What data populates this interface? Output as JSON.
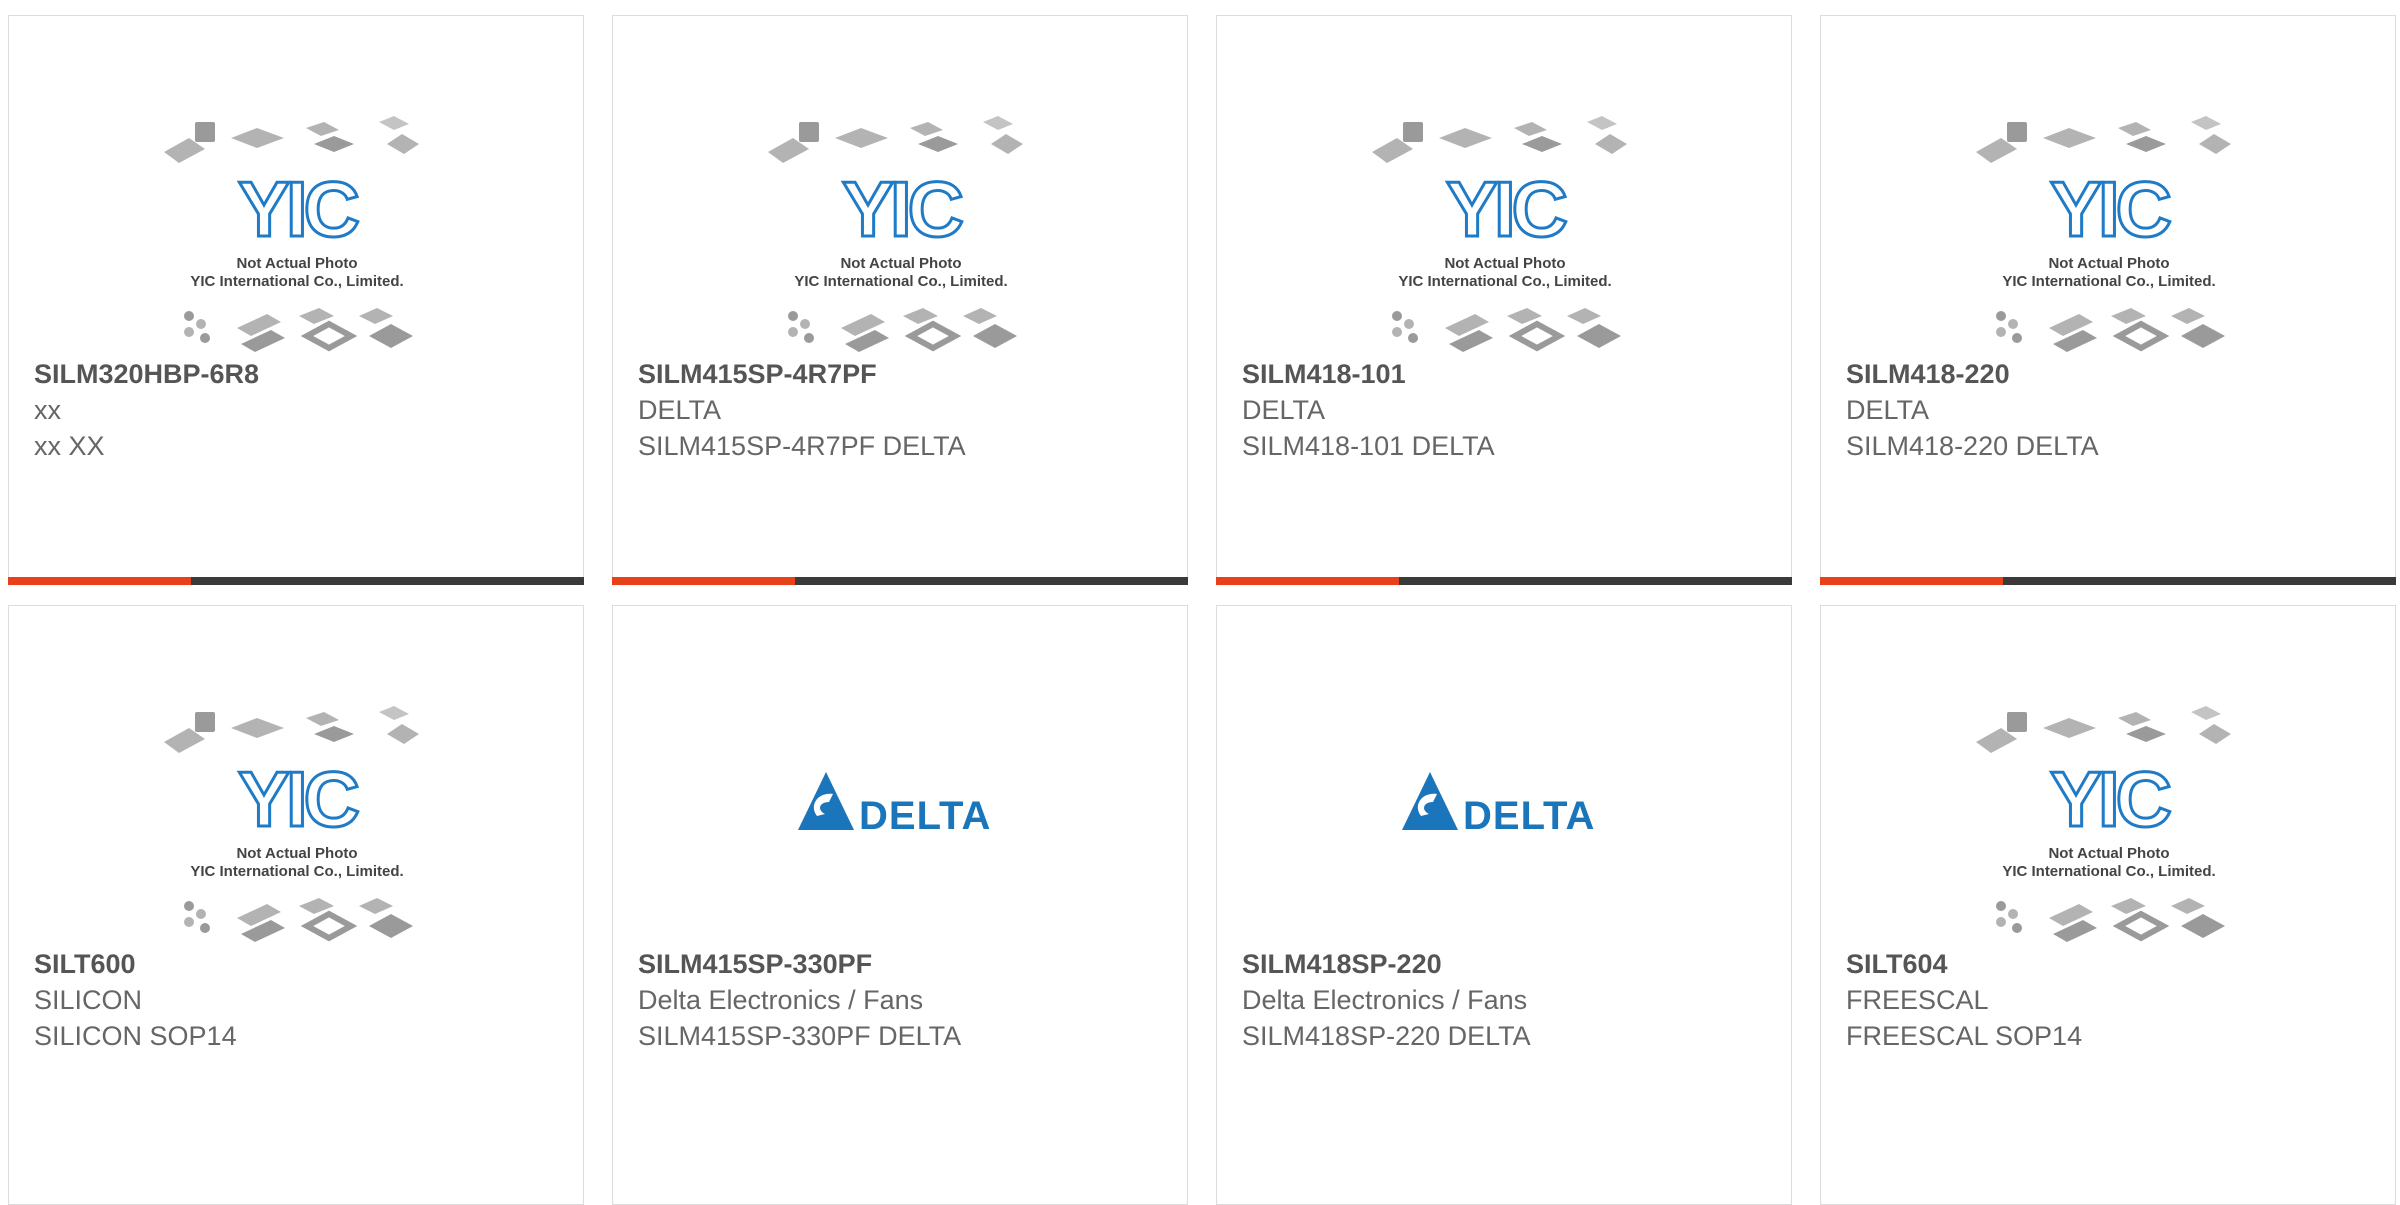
{
  "placeholder": {
    "line1": "Not Actual Photo",
    "line2": "YIC International Co., Limited.",
    "logo": "YIC"
  },
  "delta_logo_text": "DELTA",
  "colors": {
    "accent": "#e8401a",
    "bar": "#3a3a3a",
    "yic_blue": "#1f7bc6",
    "delta_blue": "#1b75bb"
  },
  "products": [
    {
      "part": "SILM320HBP-6R8",
      "mfr": "xx",
      "desc": "xx XX",
      "image": "yic-placeholder-image"
    },
    {
      "part": "SILM415SP-4R7PF",
      "mfr": "DELTA",
      "desc": "SILM415SP-4R7PF DELTA",
      "image": "yic-placeholder-image"
    },
    {
      "part": "SILM418-101",
      "mfr": "DELTA",
      "desc": "SILM418-101 DELTA",
      "image": "yic-placeholder-image"
    },
    {
      "part": "SILM418-220",
      "mfr": "DELTA",
      "desc": "SILM418-220 DELTA",
      "image": "yic-placeholder-image"
    },
    {
      "part": "SILT600",
      "mfr": "SILICON",
      "desc": "SILICON SOP14",
      "image": "yic-placeholder-image"
    },
    {
      "part": "SILM415SP-330PF",
      "mfr": "Delta Electronics / Fans",
      "desc": "SILM415SP-330PF DELTA",
      "image": "delta-logo-image"
    },
    {
      "part": "SILM418SP-220",
      "mfr": "Delta Electronics / Fans",
      "desc": "SILM418SP-220 DELTA",
      "image": "delta-logo-image"
    },
    {
      "part": "SILT604",
      "mfr": "FREESCAL",
      "desc": "FREESCAL SOP14",
      "image": "yic-placeholder-image"
    }
  ]
}
